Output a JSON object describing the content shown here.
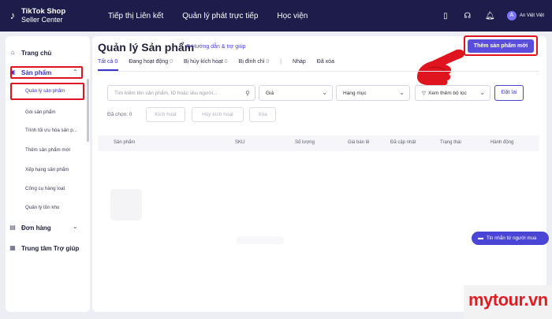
{
  "topbar": {
    "logo_line1": "TikTok Shop",
    "logo_line2": "Seller Center",
    "nav": [
      "Tiếp thị Liên kết",
      "Quản lý phát trực tiếp",
      "Học viện"
    ],
    "username": "An Việt Việt",
    "avatar_letter": "A"
  },
  "sidebar": {
    "home": "Trang chủ",
    "products": "Sản phẩm",
    "sub_items": [
      "Quản lý sản phẩm",
      "Gói sản phẩm",
      "Trình tối ưu hóa sản p...",
      "Thêm sản phẩm mới",
      "Xếp hạng sản phẩm",
      "Công cụ hàng loạt",
      "Quản lý tồn kho"
    ],
    "orders": "Đơn hàng",
    "help_center": "Trung tâm Trợ giúp"
  },
  "main": {
    "title": "Quản lý Sản phẩm",
    "help_link": "Hướng dẫn & trợ giúp",
    "add_button": "Thêm sản phẩm mới",
    "tabs": [
      {
        "label": "Tất cả",
        "count": "0"
      },
      {
        "label": "Đang hoạt động",
        "count": "0"
      },
      {
        "label": "Bị hủy kích hoạt",
        "count": "0"
      },
      {
        "label": "Bị đình chỉ",
        "count": "0"
      },
      {
        "label": "Nháp",
        "count": ""
      },
      {
        "label": "Đã xóa",
        "count": ""
      }
    ],
    "search_placeholder": "Tìm kiếm tên sản phẩm, ID hoặc sku người...",
    "filter_price": "Giá",
    "filter_category": "Hạng mục",
    "filter_more": "Xem thêm bộ lọc",
    "reset": "Đặt lại",
    "selected_label": "Đã chọn: 0",
    "bulk_activate": "Kích hoạt",
    "bulk_deactivate": "Hủy kích hoạt",
    "bulk_delete": "Xóa",
    "columns": [
      "Sản phẩm",
      "SKU",
      "Số lượng",
      "Giá bán lẻ",
      "Đã cập nhật",
      "Trạng thái",
      "Hành động"
    ]
  },
  "chat": {
    "label": "Tin nhắn từ người mua"
  },
  "watermark": "mytour.vn",
  "colors": {
    "accent": "#5a4ddc",
    "highlight": "#e0141e",
    "topbar": "#1d1c4a"
  }
}
